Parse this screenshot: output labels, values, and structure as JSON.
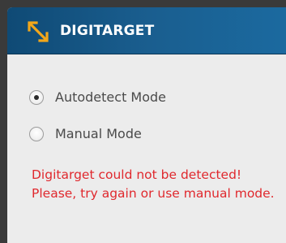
{
  "header": {
    "title": "DIGITARGET",
    "icon": "expand-arrows-icon"
  },
  "mode_options": [
    {
      "label": "Autodetect Mode",
      "selected": true
    },
    {
      "label": "Manual Mode",
      "selected": false
    }
  ],
  "error_message": "Digitarget could not be detected! Please, try again or use manual mode.",
  "colors": {
    "header_bg": "#1a5e8f",
    "icon_accent": "#f2a71b",
    "error_text": "#e0282d",
    "panel_bg": "#ececec"
  }
}
